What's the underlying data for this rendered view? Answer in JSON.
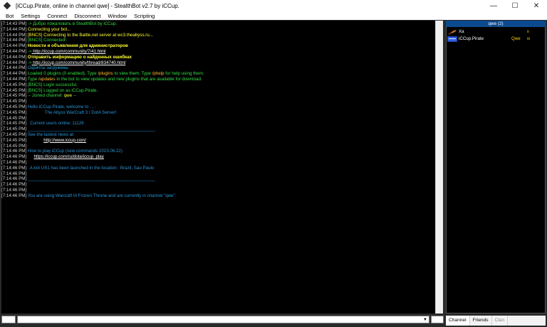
{
  "window": {
    "title": "[iCCup.Pirate, online in channel qwe] - StealthBot v2.7 by iCCup.",
    "minimize_glyph": "—",
    "maximize_glyph": "☐",
    "close_glyph": "✕"
  },
  "menu": [
    "Bot",
    "Settings",
    "Connect",
    "Disconnect",
    "Window",
    "Scripting"
  ],
  "colors": {
    "timestamp": "#cfcfcf",
    "green": "#33dd44",
    "yellow": "#ffff33",
    "white": "#ffffff",
    "cyan": "#22aadd",
    "blue": "#2a93d5",
    "orange": "#ffbb33",
    "channel_header": "#0c4a90"
  },
  "chat": [
    {
      "ts": "[7:14:43 PM]",
      "segments": [
        {
          "t": "-> Добро пожаловать в StealthBot by iCCup.",
          "c": "green"
        }
      ]
    },
    {
      "ts": "[7:14:44 PM]",
      "segments": [
        {
          "t": "Connecting your bot...",
          "c": "yellow"
        }
      ]
    },
    {
      "ts": "[7:14:44 PM]",
      "segments": [
        {
          "t": "[BNCS] Connecting to the Battle.net server at wc3.theabyss.ru...",
          "c": "yellow"
        }
      ]
    },
    {
      "ts": "[7:14:44 PM]",
      "segments": [
        {
          "t": "[BNCS] Connected!",
          "c": "green"
        }
      ]
    },
    {
      "ts": "[7:14:44 PM]",
      "segments": [
        {
          "t": "Новости и объявления для администраторов",
          "c": "yellow",
          "b": true
        }
      ]
    },
    {
      "ts": "[7:14:44 PM]",
      "segments": [
        {
          "t": "->",
          "c": "green"
        },
        {
          "t": " http://iccup.com/community/7/41.html",
          "c": "white",
          "u": true
        }
      ]
    },
    {
      "ts": "[7:14:44 PM]",
      "segments": [
        {
          "t": "Отправить информацию о найденных ошибках",
          "c": "yellow",
          "b": true
        }
      ]
    },
    {
      "ts": "[7:14:44 PM]",
      "segments": [
        {
          "t": "->",
          "c": "green"
        },
        {
          "t": " http://iccup.com/community/thread/834740.html",
          "c": "white",
          "u": true
        }
      ]
    },
    {
      "ts": "[7:14:44 PM]",
      "segments": [
        {
          "t": "Скрипты загружены",
          "c": "cyan"
        }
      ]
    },
    {
      "ts": "[7:14:44 PM]",
      "segments": [
        {
          "t": "Loaded 0 plugins (0 enabled). Type ",
          "c": "green"
        },
        {
          "t": "/plugins",
          "c": "orange"
        },
        {
          "t": " to view them. Type ",
          "c": "green"
        },
        {
          "t": "/phelp",
          "c": "orange"
        },
        {
          "t": " for help using them.",
          "c": "green"
        }
      ]
    },
    {
      "ts": "[7:14:44 PM]",
      "segments": [
        {
          "t": "Type ",
          "c": "green"
        },
        {
          "t": "/updates",
          "c": "orange"
        },
        {
          "t": " in the bot to view updates and new plugins that are available for download.",
          "c": "green"
        }
      ]
    },
    {
      "ts": "[7:14:45 PM]",
      "segments": [
        {
          "t": "[BNCS] Login successful.",
          "c": "green"
        }
      ]
    },
    {
      "ts": "[7:14:45 PM]",
      "segments": [
        {
          "t": "[BNCS] Logged on as iCCup.Pirate.",
          "c": "green"
        }
      ]
    },
    {
      "ts": "[7:14:45 PM]",
      "segments": [
        {
          "t": "-- Joined channel: ",
          "c": "green"
        },
        {
          "t": "qwe",
          "c": "yellow"
        },
        {
          "t": " --",
          "c": "green"
        }
      ]
    },
    {
      "ts": "[7:14:45 PM]",
      "segments": []
    },
    {
      "ts": "[7:14:45 PM]",
      "segments": [
        {
          "t": "Hello iCCup.Pirate, welcome to . . .",
          "c": "blue"
        }
      ]
    },
    {
      "ts": "[7:14:45 PM]",
      "segments": [
        {
          "t": "              The Abyss WarCraft 3 / DotA Server!",
          "c": "blue"
        }
      ]
    },
    {
      "ts": "[7:14:45 PM]",
      "segments": []
    },
    {
      "ts": "[7:14:45 PM]",
      "segments": [
        {
          "t": "  Current users online: 11126",
          "c": "blue"
        }
      ]
    },
    {
      "ts": "[7:14:45 PM]",
      "segments": [
        {
          "t": "____________________________________________________",
          "c": "blue"
        }
      ]
    },
    {
      "ts": "[7:14:45 PM]",
      "segments": [
        {
          "t": "See the lastest news at:",
          "c": "blue"
        }
      ]
    },
    {
      "ts": "[7:14:45 PM]",
      "segments": [
        {
          "t": "             ",
          "c": "white"
        },
        {
          "t": "http://www.iccup.com/",
          "c": "white",
          "u": true
        }
      ]
    },
    {
      "ts": "[7:14:45 PM]",
      "segments": []
    },
    {
      "ts": "[7:14:46 PM]",
      "segments": [
        {
          "t": "How to play iCCup (new commands 2023.06.22)",
          "c": "blue"
        }
      ]
    },
    {
      "ts": "[7:14:46 PM]",
      "segments": [
        {
          "t": "     ",
          "c": "white"
        },
        {
          "t": "https://iccup.com/ru/dota/iccup_play",
          "c": "white",
          "u": true
        }
      ]
    },
    {
      "ts": "[7:14:46 PM]",
      "segments": []
    },
    {
      "ts": "[7:14:46 PM]",
      "segments": [
        {
          "t": "  A bot US1 has been launched in the location:  Brazil, Sao Paulo",
          "c": "blue"
        }
      ]
    },
    {
      "ts": "[7:14:46 PM]",
      "segments": []
    },
    {
      "ts": "[7:14:46 PM]",
      "segments": [
        {
          "t": "____________________________________________________",
          "c": "blue"
        }
      ]
    },
    {
      "ts": "[7:14:46 PM]",
      "segments": []
    },
    {
      "ts": "[7:14:46 PM]",
      "segments": []
    },
    {
      "ts": "[7:14:46 PM]",
      "segments": [
        {
          "t": "You are using Warcraft III Frozen Throne and are currently in channel \"qwe\".",
          "c": "blue"
        }
      ]
    }
  ],
  "channel": {
    "header": "qwe (2)",
    "users": [
      {
        "name": "Xa",
        "clan": "",
        "lag": "ıı",
        "icon": "broom-icon"
      },
      {
        "name": "iCCup.Pirate",
        "clan": "Qwe",
        "lag": "ııı",
        "icon": "clan-badge-icon"
      }
    ]
  },
  "tabs": [
    {
      "label": "Channel",
      "state": "active"
    },
    {
      "label": "Friends",
      "state": "normal"
    },
    {
      "label": "Clan",
      "state": "disabled"
    }
  ],
  "entry": {
    "value": "",
    "dropdown_glyph": "▼"
  }
}
